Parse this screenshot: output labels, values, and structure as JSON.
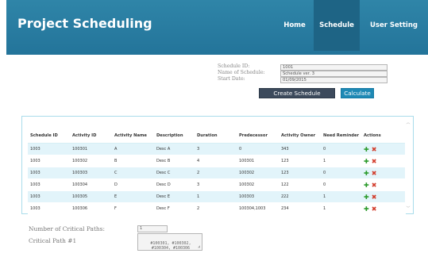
{
  "header": {
    "title": "Project Scheduling",
    "nav": [
      {
        "label": "Home"
      },
      {
        "label": "Schedule"
      },
      {
        "label": "User Setting"
      }
    ]
  },
  "form": {
    "schedule_id_label": "Schedule ID:",
    "schedule_name_label": "Name of Schedule:",
    "start_date_label": "Start Date:",
    "schedule_id_value": "1001",
    "schedule_name_value": "Schedule ver. 3",
    "start_date_value": "01/09/2015",
    "create_button": "Create Schedule",
    "calculate_button": "Calculate"
  },
  "table": {
    "headers": [
      "Schedule ID",
      "Activity ID",
      "Activity Name",
      "Description",
      "Duration",
      "Predecessor",
      "Activity Owner",
      "Need Reminder",
      "Actions"
    ],
    "rows": [
      [
        "1003",
        "100301",
        "A",
        "Desc A",
        "3",
        "0",
        "343",
        "0"
      ],
      [
        "1003",
        "100302",
        "B",
        "Desc B",
        "4",
        "100301",
        "123",
        "1"
      ],
      [
        "1003",
        "100303",
        "C",
        "Desc C",
        "2",
        "100302",
        "123",
        "0"
      ],
      [
        "1003",
        "100304",
        "D",
        "Desc D",
        "3",
        "100302",
        "122",
        "0"
      ],
      [
        "1003",
        "100305",
        "E",
        "Desc E",
        "1",
        "100303",
        "222",
        "1"
      ],
      [
        "1003",
        "100306",
        "F",
        "Desc F",
        "2",
        "100304,1003",
        "234",
        "1"
      ]
    ],
    "add_glyph": "✚",
    "delete_glyph": "✖"
  },
  "critical": {
    "count_label": "Number of Critical Paths:",
    "count_value": "1",
    "path_label": "Critical Path #1",
    "path_value": "#100301, #100302,\n#100304, #100306"
  },
  "colors": {
    "header_bg": "#2a7ca2",
    "nav_active_bg": "#1e6485",
    "row_alt_bg": "#e2f4fa",
    "create_button_bg": "#3c4a5c",
    "calculate_button_bg": "#1e89b5",
    "add_icon": "#2a9a2a",
    "delete_icon": "#d23b2a"
  }
}
